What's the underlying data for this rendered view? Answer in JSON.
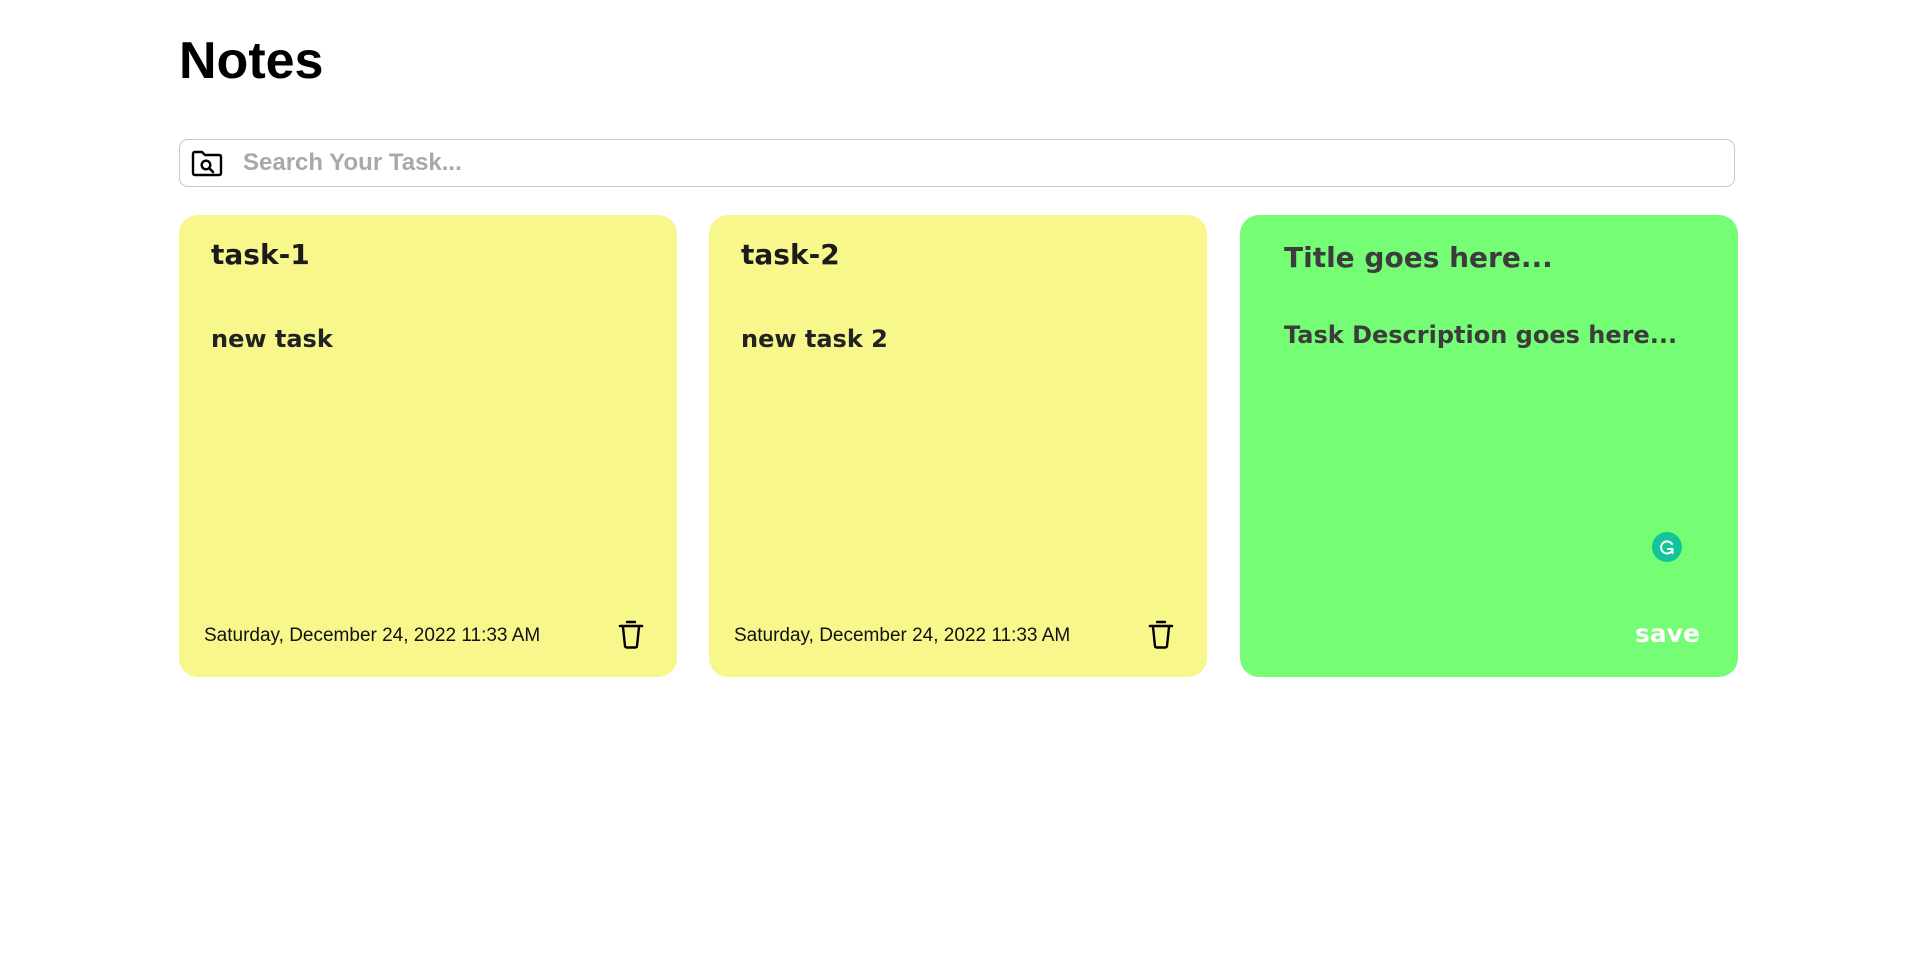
{
  "page": {
    "title": "Notes"
  },
  "search": {
    "placeholder": "Search Your Task...",
    "icon": "folder-search-icon"
  },
  "notes": [
    {
      "title": "task-1",
      "description": "new task",
      "date": "Saturday, December 24, 2022 11:33 AM",
      "color": "#f7f78c"
    },
    {
      "title": "task-2",
      "description": "new task 2",
      "date": "Saturday, December 24, 2022 11:33 AM",
      "color": "#f7f78c"
    }
  ],
  "new_note": {
    "title_placeholder": "Title goes here...",
    "description_placeholder": "Task Description goes here...",
    "save_label": "save",
    "color": "#75fd75"
  },
  "icons": {
    "delete": "trash-icon",
    "grammarly": "grammarly-icon"
  }
}
